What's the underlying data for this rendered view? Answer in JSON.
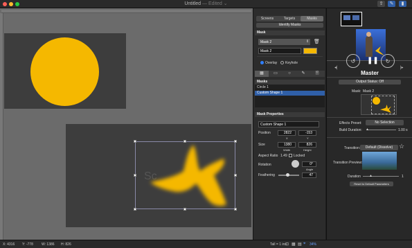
{
  "window": {
    "title": "Untitled",
    "subtitle": "— Edited ⌄"
  },
  "toolbar": {
    "icons": [
      "upload-icon",
      "edit-icon",
      "sidebar-icon"
    ]
  },
  "tabs": [
    {
      "label": "Screens",
      "active": false
    },
    {
      "label": "Targets",
      "active": false
    },
    {
      "label": "Masks",
      "active": true
    }
  ],
  "identify_button": "Identify Masks",
  "mask_section": {
    "title": "Mask",
    "selected": "Mask 2",
    "name_value": "Mask 2",
    "color": "#f5b800",
    "overlay_label": "Overlay",
    "keyhole_label": "Keyhole"
  },
  "masks": {
    "title": "Masks",
    "items": [
      {
        "label": "Circle 1",
        "selected": false
      },
      {
        "label": "Custom Shape 1",
        "selected": true
      }
    ]
  },
  "mask_properties": {
    "title": "Mask Properties",
    "name_value": "Custom Shape 1",
    "position_label": "Position",
    "position_x": "2822",
    "position_y": "-153",
    "x_label": "X",
    "y_label": "Y",
    "size_label": "Size",
    "width": "1380",
    "height": "826",
    "width_label": "Width",
    "height_label": "Height",
    "aspect_label": "Aspect Ratio",
    "aspect_value": "1.49",
    "locked_label": "Locked",
    "rotation_label": "Rotation",
    "rotation_value": "0°",
    "angle_label": "Angle",
    "feathering_label": "Feathering",
    "feathering_value": "47"
  },
  "status_bar": {
    "x": "X: 4316",
    "y": "Y: -778",
    "w": "W: 1386",
    "h": "H: 826",
    "zoom_hint": "Tall = 1 ins",
    "zoom_value": "34%"
  },
  "right_panel": {
    "title": "Master",
    "output_status": "Output Status: Off",
    "mask_label": "Mask:",
    "mask_value": "Mask 2",
    "effects_label": "Effects Preset:",
    "effects_value": "No Selection",
    "build_label": "Build Duration:",
    "build_value": "1.00 s",
    "transition_label": "Transition:",
    "transition_value": "Default (Dissolve)",
    "preview_label": "Transition Preview:",
    "duration_label": "Duration",
    "duration_value": "1",
    "reset_label": "Reset to Default Parameters"
  },
  "canvas": {
    "watermark": "Sc"
  },
  "colors": {
    "accent": "#f5b800",
    "selection": "#2f5fa8"
  }
}
